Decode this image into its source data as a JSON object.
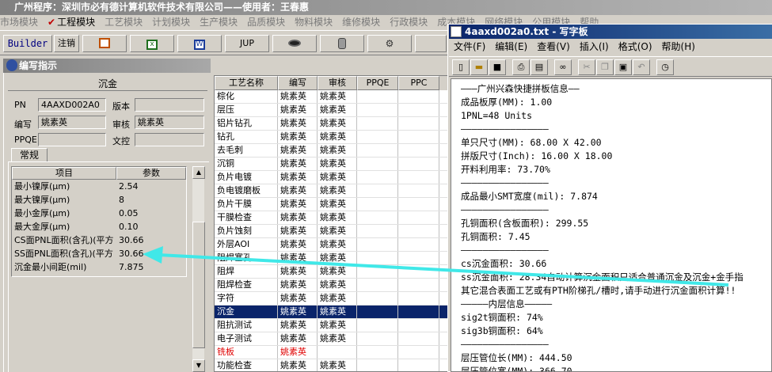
{
  "app": {
    "title": "广州程序：深圳市必有德计算机软件技术有限公司——使用者：王春惠",
    "menu": [
      "市场模块",
      "工程模块",
      "工艺模块",
      "计划模块",
      "生产模块",
      "品质模块",
      "物料模块",
      "维修模块",
      "行政模块",
      "成本模块",
      "网络模块",
      "公用模块",
      "帮助"
    ],
    "toolbar": {
      "builder": "Builder",
      "logout": "注销",
      "jup": "JUP"
    }
  },
  "left_panel": {
    "title": "编写指示",
    "section": "沉金",
    "fields": {
      "pn_label": "PN",
      "pn_value": "4AAXD002A0",
      "version_label": "版本",
      "version_value": "",
      "author_label": "编写",
      "author_value": "姚素英",
      "reviewer_label": "审核",
      "reviewer_value": "姚素英",
      "ppqe_label": "PPQE",
      "ppqe_value": "",
      "control_label": "文控",
      "control_value": ""
    },
    "tab": "常规",
    "params_header": {
      "item": "项目",
      "param": "参数"
    },
    "params": [
      {
        "k": "最小镍厚(μm)",
        "v": "2.54"
      },
      {
        "k": "最大镍厚(μm)",
        "v": "8"
      },
      {
        "k": "最小金厚(μm)",
        "v": "0.05"
      },
      {
        "k": "最大金厚(μm)",
        "v": "0.10"
      },
      {
        "k": "CS面PNL面积(含孔)(平方",
        "v": "30.66"
      },
      {
        "k": "SS面PNL面积(含孔)(平方",
        "v": "30.66"
      },
      {
        "k": "沉金最小间距(mil)",
        "v": "7.875"
      }
    ]
  },
  "process_list": {
    "headers": [
      "工艺名称",
      "编写",
      "审核",
      "PPQE",
      "PPC"
    ],
    "rows": [
      [
        "棕化",
        "姚素英",
        "姚素英"
      ],
      [
        "层压",
        "姚素英",
        "姚素英"
      ],
      [
        "铝片钻孔",
        "姚素英",
        "姚素英"
      ],
      [
        "钻孔",
        "姚素英",
        "姚素英"
      ],
      [
        "去毛刺",
        "姚素英",
        "姚素英"
      ],
      [
        "沉铜",
        "姚素英",
        "姚素英"
      ],
      [
        "负片电镀",
        "姚素英",
        "姚素英"
      ],
      [
        "负电镀磨板",
        "姚素英",
        "姚素英"
      ],
      [
        "负片干膜",
        "姚素英",
        "姚素英"
      ],
      [
        "干膜检查",
        "姚素英",
        "姚素英"
      ],
      [
        "负片蚀刻",
        "姚素英",
        "姚素英"
      ],
      [
        "外层AOI",
        "姚素英",
        "姚素英"
      ],
      [
        "阻焊塞孔",
        "姚素英",
        "姚素英"
      ],
      [
        "阻焊",
        "姚素英",
        "姚素英"
      ],
      [
        "阻焊检查",
        "姚素英",
        "姚素英"
      ],
      [
        "字符",
        "姚素英",
        "姚素英"
      ],
      [
        "沉金",
        "姚素英",
        "姚素英"
      ],
      [
        "阻抗测试",
        "姚素英",
        "姚素英"
      ],
      [
        "电子测试",
        "姚素英",
        "姚素英"
      ],
      [
        "铣板",
        "姚素英",
        ""
      ],
      [
        "功能检查",
        "姚素英",
        "姚素英"
      ]
    ],
    "selected_index": 16,
    "red_index": 19
  },
  "wordpad": {
    "title": "4aaxd002a0.txt - 写字板",
    "menu": [
      "文件(F)",
      "编辑(E)",
      "查看(V)",
      "插入(I)",
      "格式(O)",
      "帮助(H)"
    ],
    "lines": [
      "———广州兴森快捷拼板信息——",
      "成品板厚(MM): 1.00",
      "1PNL=48 Units",
      "————————————————",
      "单只尺寸(MM): 68.00 X 42.00",
      "拼版尺寸(Inch): 16.00 X 18.00",
      "开料利用率: 73.70%",
      "————————————————",
      "成品最小SMT宽度(mil): 7.874",
      "————————————————",
      "孔铜面积(含板面积): 299.55",
      "孔铜面积: 7.45",
      "————————————————",
      "cs沉金面积: 30.66",
      "ss沉金面积: 28.34自动计算沉金面积只适合普通沉金及沉金+金手指",
      "其它混合表面工艺或有PTH阶梯孔/槽时,请手动进行沉金面积计算!!",
      "—————内层信息—————",
      "sig2t铜面积: 74%",
      "sig3b铜面积: 64%",
      "————————————————",
      "层压管位长(MM): 444.50",
      "层压管位宽(MM): 366.70"
    ]
  },
  "colors": {
    "arrow": "#40e8e8",
    "selection": "#0a246a",
    "titlebar": "#0a246a"
  }
}
